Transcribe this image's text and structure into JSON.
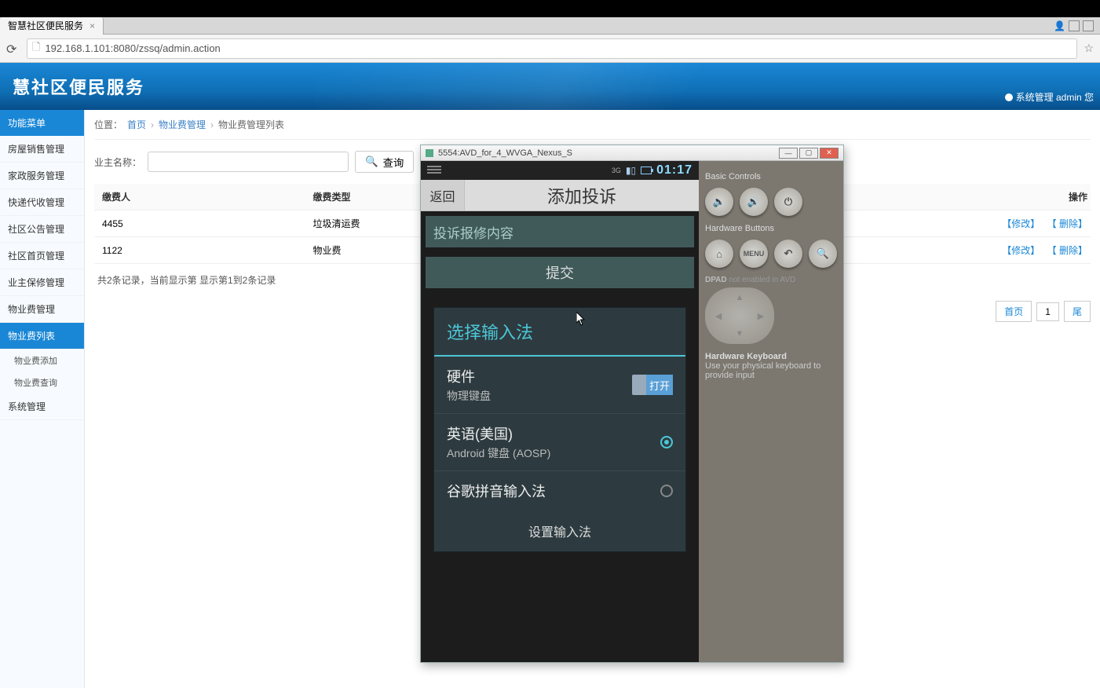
{
  "browser": {
    "tab_title": "智慧社区便民服务",
    "url": "192.168.1.101:8080/zssq/admin.action"
  },
  "banner": {
    "title": "慧社区便民服务",
    "user_label": "系统管理 admin 您"
  },
  "sidebar": {
    "header": "功能菜单",
    "items": [
      "房屋销售管理",
      "家政服务管理",
      "快递代收管理",
      "社区公告管理",
      "社区首页管理",
      "业主保修管理",
      "物业费管理"
    ],
    "subs": {
      "active": "物业费列表",
      "others": [
        "物业费添加",
        "物业费查询"
      ]
    },
    "tail": "系统管理"
  },
  "breadcrumb": {
    "label": "位置：",
    "items": [
      "首页",
      "物业费管理",
      "物业费管理列表"
    ]
  },
  "search": {
    "label": "业主名称：",
    "btn": "查询"
  },
  "table": {
    "headers": [
      "缴费人",
      "缴费类型",
      "操作"
    ],
    "rows": [
      {
        "payer": "4455",
        "type": "垃圾清运费",
        "ops": [
          "【修改】",
          "【 删除】"
        ]
      },
      {
        "payer": "1122",
        "type": "物业费",
        "ops": [
          "【修改】",
          "【 删除】"
        ]
      }
    ]
  },
  "summary": "共2条记录，当前显示第  显示第1到2条记录",
  "pager": {
    "home": "首页",
    "page": "1"
  },
  "emulator": {
    "title": "5554:AVD_for_4_WVGA_Nexus_S",
    "status": {
      "net": "3G",
      "time": "01:17"
    },
    "app": {
      "back": "返回",
      "title": "添加投诉",
      "placeholder": "投诉报修内容",
      "submit": "提交"
    },
    "ime": {
      "title": "选择输入法",
      "hw_title": "硬件",
      "hw_sub": "物理键盘",
      "switch_on": "打开",
      "en_title": "英语(美国)",
      "en_sub": "Android 键盘 (AOSP)",
      "pinyin": "谷歌拼音输入法",
      "footer": "设置输入法"
    },
    "controls": {
      "basic": "Basic Controls",
      "hw": "Hardware Buttons",
      "dpad": "DPAD",
      "dpad_note": "not enabled in AVD",
      "kb": "Hardware Keyboard",
      "kb_note": "Use your physical keyboard to provide input",
      "menu": "MENU"
    }
  }
}
